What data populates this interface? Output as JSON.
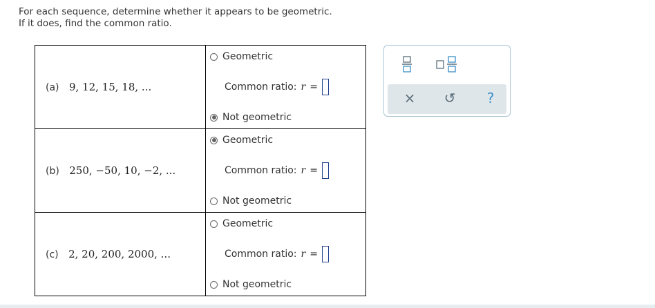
{
  "instructions": {
    "line1": "For each sequence, determine whether it appears to be geometric.",
    "line2": "If it does, find the common ratio."
  },
  "questions": [
    {
      "label": "(a)",
      "sequence": "9, 12, 15, 18, ...",
      "option_geometric": "Geometric",
      "ratio_label": "Common ratio:",
      "ratio_var": "r",
      "ratio_eq": "=",
      "option_not": "Not geometric",
      "selected": "not_geometric"
    },
    {
      "label": "(b)",
      "sequence": "250, −50, 10, −2, ...",
      "option_geometric": "Geometric",
      "ratio_label": "Common ratio:",
      "ratio_var": "r",
      "ratio_eq": "=",
      "option_not": "Not geometric",
      "selected": "geometric"
    },
    {
      "label": "(c)",
      "sequence": "2, 20, 200, 2000, ...",
      "option_geometric": "Geometric",
      "ratio_label": "Common ratio:",
      "ratio_var": "r",
      "ratio_eq": "=",
      "option_not": "Not geometric",
      "selected": "none"
    }
  ],
  "toolbox": {
    "icons": [
      "fraction-icon",
      "mixed-number-icon"
    ],
    "clear_symbol": "×",
    "undo_symbol": "↺",
    "help_symbol": "?",
    "icon_color": "#5a6e7a",
    "accent_color": "#3a8fc7"
  }
}
